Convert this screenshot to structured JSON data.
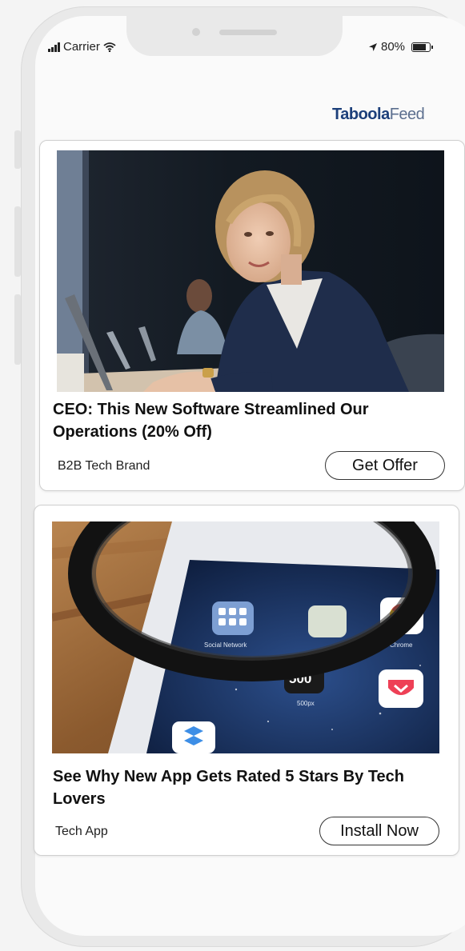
{
  "status_bar": {
    "carrier": "Carrier",
    "battery": "80%",
    "battery_level": 0.8
  },
  "brand": {
    "part1": "Taboola",
    "part2": "Feed"
  },
  "cards": [
    {
      "title": "CEO: This New Software Streamlined Our Operations (20% Off)",
      "source": "B2B Tech Brand",
      "cta": "Get Offer",
      "image": "woman-at-laptop-photo"
    },
    {
      "title": "See Why New App Gets Rated 5 Stars By Tech Lovers",
      "source": "Tech App",
      "cta": "Install Now",
      "image": "tablet-magnifier-photo"
    }
  ],
  "tablet": {
    "folder_label": "Social Network",
    "chrome_label": "Chrome",
    "pocket_label": "Pocket",
    "app_500_label": "500",
    "flipboard_label": "Flipboard",
    "app_500_caption": "500px"
  }
}
